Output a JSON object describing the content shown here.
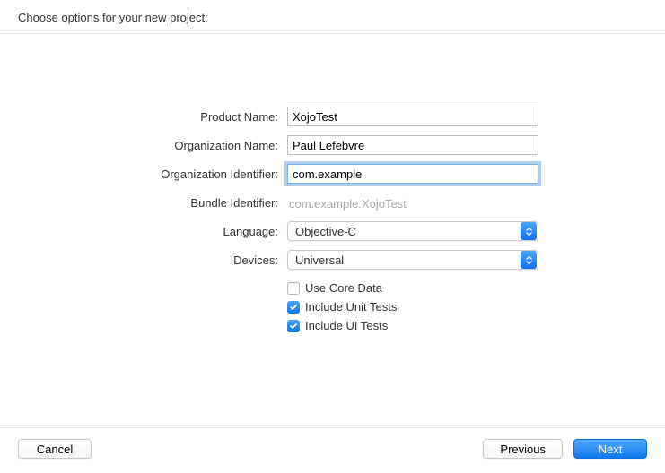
{
  "header": {
    "title": "Choose options for your new project:"
  },
  "form": {
    "productName": {
      "label": "Product Name:",
      "value": "XojoTest"
    },
    "orgName": {
      "label": "Organization Name:",
      "value": "Paul Lefebvre"
    },
    "orgId": {
      "label": "Organization Identifier:",
      "value": "com.example"
    },
    "bundleId": {
      "label": "Bundle Identifier:",
      "value": "com.example.XojoTest"
    },
    "language": {
      "label": "Language:",
      "value": "Objective-C"
    },
    "devices": {
      "label": "Devices:",
      "value": "Universal"
    }
  },
  "checkboxes": {
    "coreData": {
      "label": "Use Core Data",
      "checked": false
    },
    "unitTests": {
      "label": "Include Unit Tests",
      "checked": true
    },
    "uiTests": {
      "label": "Include UI Tests",
      "checked": true
    }
  },
  "buttons": {
    "cancel": "Cancel",
    "previous": "Previous",
    "next": "Next"
  }
}
